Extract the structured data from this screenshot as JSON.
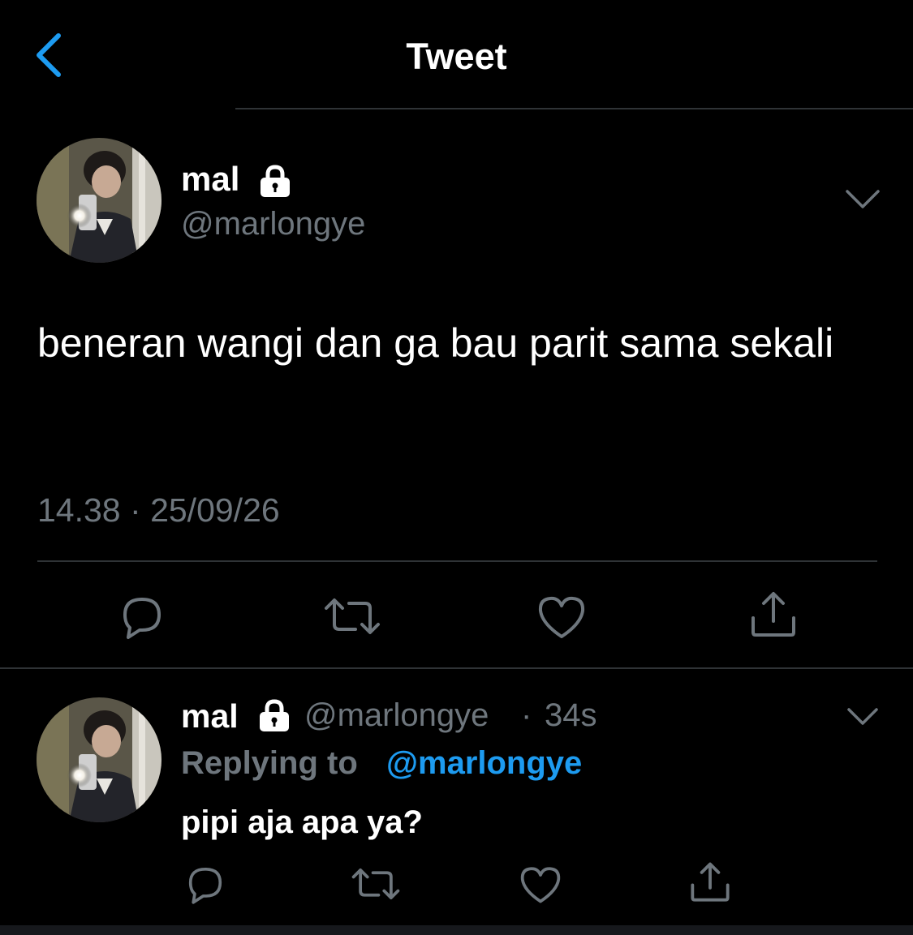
{
  "header": {
    "title": "Tweet",
    "back_icon": "chevron-left-icon"
  },
  "colors": {
    "background": "#000000",
    "text": "#ffffff",
    "secondary_text": "#6e767d",
    "accent": "#1d9bf0",
    "divider": "#2f3336"
  },
  "main_tweet": {
    "author_name": "mal",
    "author_handle": "@marlongye",
    "protected_icon": "lock-icon",
    "text": "beneran wangi dan ga bau parit sama sekali",
    "time": "14.38",
    "separator": "·",
    "date": "25/09/26",
    "actions": [
      "reply-icon",
      "retweet-icon",
      "like-icon",
      "share-icon"
    ]
  },
  "reply_tweet": {
    "author_name": "mal",
    "author_handle": "@marlongye",
    "separator": "·",
    "time_ago": "34s",
    "replying_label": "Replying to",
    "replying_handle": "@marlongye",
    "text": "pipi aja apa ya?",
    "actions": [
      "reply-icon",
      "retweet-icon",
      "like-icon",
      "share-icon"
    ]
  }
}
